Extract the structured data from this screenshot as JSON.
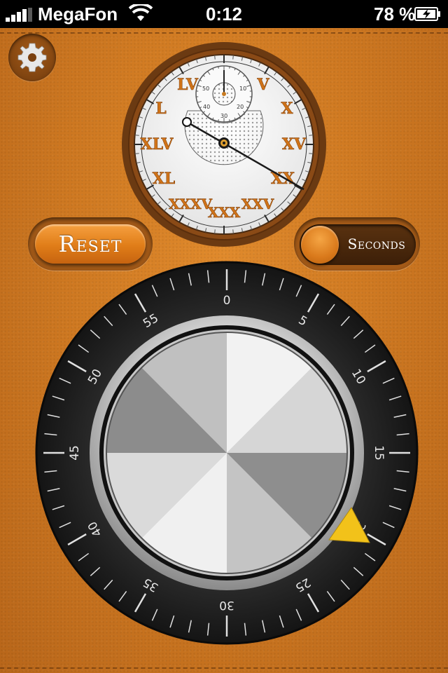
{
  "status_bar": {
    "carrier": "MegaFon",
    "time": "0:12",
    "battery_percent": "78 %"
  },
  "controls": {
    "reset_label": "Reset",
    "mode_label": "Seconds",
    "settings_icon": "gear-icon"
  },
  "stopwatch": {
    "main_numerals": [
      "LV",
      "V",
      "X",
      "XV",
      "XX",
      "XXV",
      "XXX",
      "XXXV",
      "XL",
      "XLV",
      "L"
    ],
    "sub_dial_labels": [
      "10",
      "20",
      "30",
      "40",
      "50"
    ]
  },
  "dial": {
    "labels": [
      "0",
      "5",
      "10",
      "15",
      "20",
      "25",
      "30",
      "35",
      "40",
      "45",
      "50",
      "55"
    ]
  },
  "colors": {
    "leather": "#d07a22",
    "accent_orange": "#e88a2a",
    "pointer_yellow": "#f2c21a",
    "dial_black": "#1a1a1a"
  }
}
